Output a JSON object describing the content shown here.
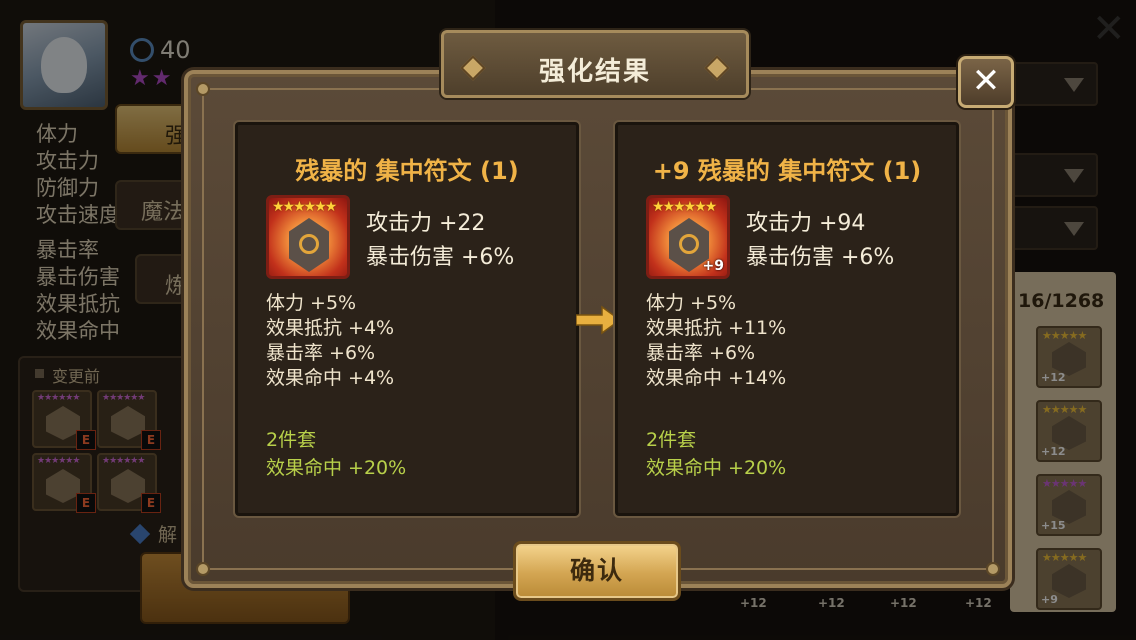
{
  "background": {
    "level_text": "40",
    "stats_labels": [
      "体力",
      "攻击力",
      "防御力",
      "攻击速度",
      "暴击率",
      "暴击伤害",
      "效果抵抗",
      "效果命中"
    ],
    "tabs": [
      "强化",
      "魔法",
      "炼化"
    ],
    "change_label": "变更前",
    "unlock_label": "解",
    "rune_count": "16/1268",
    "right_slot_levels": [
      "+12",
      "+12",
      "+15",
      "+9"
    ],
    "bottom_levels": [
      "+12",
      "+12",
      "+12",
      "+12"
    ]
  },
  "modal": {
    "title": "强化结果",
    "close_label": "✕",
    "confirm_label": "确认"
  },
  "before": {
    "name": "残暴的 集中符文 (1)",
    "stars": "★★★★★★",
    "level_badge": "",
    "main_stat": "攻击力 +22",
    "prefix_stat": "暴击伤害 +6%",
    "substats": [
      "体力 +5%",
      "效果抵抗 +4%",
      "暴击率 +6%",
      "效果命中 +4%"
    ],
    "set_title": "2件套",
    "set_bonus": "效果命中 +20%"
  },
  "after": {
    "name": "+9 残暴的 集中符文 (1)",
    "stars": "★★★★★★",
    "level_badge": "+9",
    "main_stat": "攻击力 +94",
    "prefix_stat": "暴击伤害 +6%",
    "substats": [
      "体力 +5%",
      "效果抵抗 +11%",
      "暴击率 +6%",
      "效果命中 +14%"
    ],
    "set_title": "2件套",
    "set_bonus": "效果命中 +20%"
  },
  "colors": {
    "title_gold": "#f0b347",
    "set_green": "#b8d04a",
    "arrow_gold": "#e8b040"
  }
}
